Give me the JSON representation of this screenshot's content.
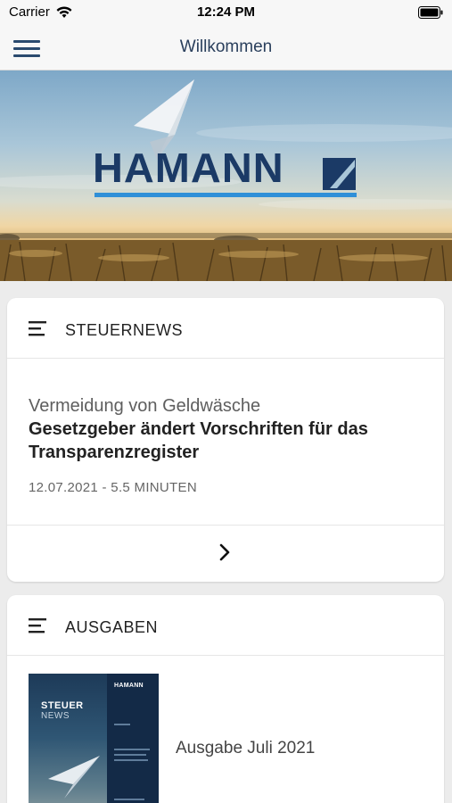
{
  "status_bar": {
    "carrier": "Carrier",
    "time": "12:24 PM"
  },
  "nav": {
    "title": "Willkommen",
    "menu_icon": "hamburger-menu-icon"
  },
  "hero": {
    "logo": "HAMANN"
  },
  "news_card": {
    "title": "STEUERNEWS",
    "kicker": "Vermeidung von Geldwäsche",
    "headline": "Gesetzgeber ändert Vorschriften für das Transparenzregister",
    "meta": "12.07.2021 - 5.5 MINUTEN",
    "more_icon": "chevron-right-icon"
  },
  "issues_card": {
    "title": "AUSGABEN",
    "items": [
      {
        "label": "Ausgabe Juli 2021",
        "cover_title": "STEUER",
        "cover_subtitle": "NEWS",
        "cover_logo": "HAMANN"
      }
    ]
  },
  "colors": {
    "brand_blue": "#1b3a66",
    "accent_blue": "#2f8fd8",
    "nav_text": "#2a3f5c"
  }
}
